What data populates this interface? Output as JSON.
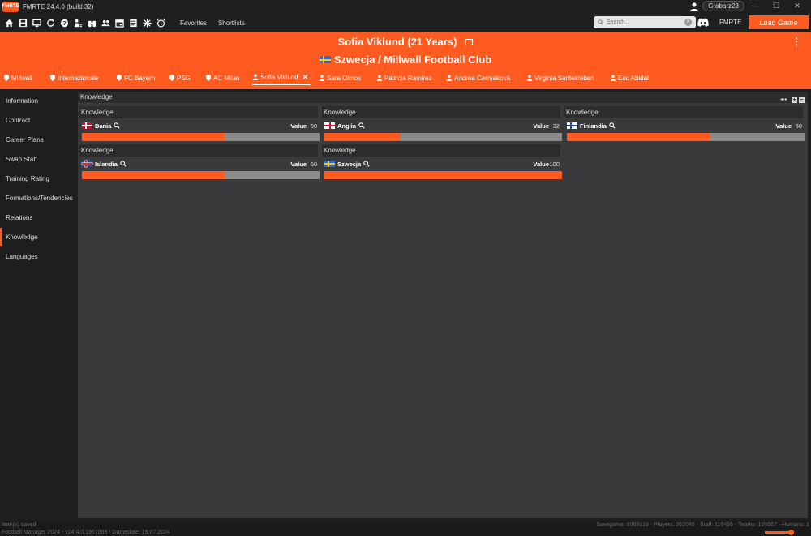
{
  "app": {
    "title": "FMRTE 24.4.0 (build 32)",
    "logo_text": "FMRTE",
    "username": "Grabarz23",
    "window_controls": [
      "—",
      "☐",
      "✕"
    ]
  },
  "toolbar": {
    "icons": [
      "home-icon",
      "save-icon",
      "monitor-icon",
      "refresh-icon",
      "help-icon",
      "person-search-icon",
      "binoculars-icon",
      "people-icon",
      "calendar-icon",
      "notes-icon",
      "snowflake-icon",
      "alarm-icon"
    ],
    "favorites_label": "Favorites",
    "shortlists_label": "Shortlists",
    "search_placeholder": "Search...",
    "search_clear": "✕",
    "fmrte_label": "FMRTE",
    "load_button": "Load Game"
  },
  "header": {
    "player_title": "Sofia Viklund (21 Years)",
    "club_title": "Szwecja / Millwall Football Club",
    "kebab": "⋮",
    "tabs": [
      {
        "label": "Millwall",
        "icon": "shield-icon",
        "active": false
      },
      {
        "label": "Internazionale",
        "icon": "shield-icon",
        "active": false
      },
      {
        "label": "FC Bayern",
        "icon": "shield-icon",
        "active": false
      },
      {
        "label": "PSG",
        "icon": "shield-icon",
        "active": false
      },
      {
        "label": "AC Milan",
        "icon": "shield-icon",
        "active": false
      },
      {
        "label": "Sofia Viklund",
        "icon": "person-icon",
        "active": true,
        "close": "✕"
      },
      {
        "label": "Sara Olmos",
        "icon": "person-icon",
        "active": false
      },
      {
        "label": "Patricia Ramirez",
        "icon": "person-icon",
        "active": false
      },
      {
        "label": "Andrea Čermáková",
        "icon": "person-icon",
        "active": false
      },
      {
        "label": "Virginia Santesteban",
        "icon": "person-icon",
        "active": false
      },
      {
        "label": "Eric Abidal",
        "icon": "person-icon",
        "active": false
      }
    ]
  },
  "sidebar": {
    "items": [
      {
        "label": "Information",
        "active": false
      },
      {
        "label": "Contract",
        "active": false
      },
      {
        "label": "Career Plans",
        "active": false
      },
      {
        "label": "Swap Staff",
        "active": false
      },
      {
        "label": "Training Rating",
        "active": false
      },
      {
        "label": "Formations/Tendencies",
        "active": false
      },
      {
        "label": "Relations",
        "active": false
      },
      {
        "label": "Knowledge",
        "active": true
      },
      {
        "label": "Languages",
        "active": false
      }
    ]
  },
  "panel": {
    "title": "Knowledge",
    "controls": {
      "arrows": "◂▸▸",
      "add": "+",
      "remove": "−"
    }
  },
  "knowledge_cards": [
    {
      "heading": "Knowledge",
      "country": "Dania",
      "flag": "denmark",
      "value_label": "Value",
      "value": 60
    },
    {
      "heading": "Knowledge",
      "country": "Anglia",
      "flag": "england",
      "value_label": "Value",
      "value": 32
    },
    {
      "heading": "Knowledge",
      "country": "Finlandia",
      "flag": "finland",
      "value_label": "Value",
      "value": 60
    },
    {
      "heading": "Knowledge",
      "country": "Islandia",
      "flag": "iceland",
      "value_label": "Value",
      "value": 60
    },
    {
      "heading": "Knowledge",
      "country": "Szwecja",
      "flag": "sweden",
      "value_label": "Value",
      "value": 100
    }
  ],
  "value_max": 100,
  "status": {
    "left_line1": "Item(s) saved",
    "left_line2": "Football Manager 2024 - v24.4.0.1967899 / Gamedate: 19.07.2024",
    "right": "Savegame: 9089319 - Players: 362048 - Staff: 116495 - Teams: 100567 - Humans: 1"
  },
  "colors": {
    "accent": "#ff5a1f",
    "bar_empty": "#8a8a8a",
    "background": "#1e1e1e",
    "content": "#3a3a3c"
  }
}
